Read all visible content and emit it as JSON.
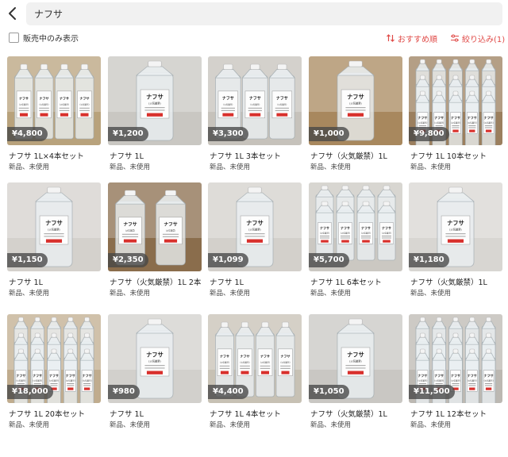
{
  "search": {
    "value": "ナフサ"
  },
  "filters": {
    "on_sale_only_label": "販売中のみ表示",
    "sort_label": "おすすめ順",
    "refine_label": "絞り込み(1)",
    "accent_color": "#e04a47"
  },
  "products": [
    {
      "price": "¥4,800",
      "title": "ナフサ 1L×4本セット",
      "condition": "新品、未使用"
    },
    {
      "price": "¥1,200",
      "title": "ナフサ 1L",
      "condition": "新品、未使用"
    },
    {
      "price": "¥3,300",
      "title": "ナフサ 1L 3本セット",
      "condition": "新品、未使用"
    },
    {
      "price": "¥1,000",
      "title": "ナフサ（火気厳禁）1L",
      "condition": "新品、未使用"
    },
    {
      "price": "¥9,800",
      "title": "ナフサ 1L 10本セット",
      "condition": "新品、未使用"
    },
    {
      "price": "¥1,150",
      "title": "ナフサ 1L",
      "condition": "新品、未使用"
    },
    {
      "price": "¥2,350",
      "title": "ナフサ（火気厳禁）1L 2本",
      "condition": "新品、未使用"
    },
    {
      "price": "¥1,099",
      "title": "ナフサ 1L",
      "condition": "新品、未使用"
    },
    {
      "price": "¥5,700",
      "title": "ナフサ 1L 6本セット",
      "condition": "新品、未使用"
    },
    {
      "price": "¥1,180",
      "title": "ナフサ（火気厳禁）1L",
      "condition": "新品、未使用"
    },
    {
      "price": "¥18,000",
      "title": "ナフサ 1L 20本セット",
      "condition": "新品、未使用"
    },
    {
      "price": "¥980",
      "title": "ナフサ 1L",
      "condition": "新品、未使用"
    },
    {
      "price": "¥4,400",
      "title": "ナフサ 1L 4本セット",
      "condition": "新品、未使用"
    },
    {
      "price": "¥1,050",
      "title": "ナフサ（火気厳禁）1L",
      "condition": "新品、未使用"
    },
    {
      "price": "¥11,500",
      "title": "ナフサ 1L 12本セット",
      "condition": "新品、未使用"
    }
  ],
  "photo_label": {
    "name": "ナフサ",
    "sub": "(火気厳禁)",
    "warn": "火気厳禁"
  }
}
